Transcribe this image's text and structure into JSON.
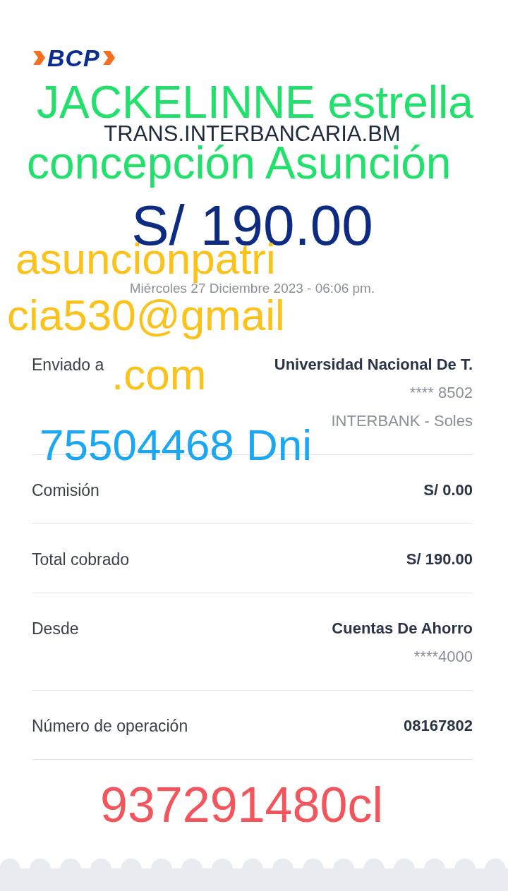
{
  "logo": {
    "text": "BCP"
  },
  "title": "TRANS.INTERBANCARIA.BM",
  "amount": "S/ 190.00",
  "date": "Miércoles 27 Diciembre 2023 - 06:06 pm.",
  "details": [
    {
      "label": "Enviado a",
      "values": [
        "Universidad Nacional De T.",
        "**** 8502",
        "INTERBANK - Soles"
      ]
    },
    {
      "label": "Comisión",
      "values": [
        "S/ 0.00"
      ]
    },
    {
      "label": "Total cobrado",
      "values": [
        "S/ 190.00"
      ]
    },
    {
      "label": "Desde",
      "values": [
        "Cuentas De Ahorro",
        "****4000"
      ]
    },
    {
      "label": "Número de operación",
      "values": [
        "08167802"
      ]
    }
  ],
  "annotations": [
    {
      "text": "JACKELINNE estrella",
      "color": "#22e06c"
    },
    {
      "text": "concepción Asunción",
      "color": "#22e06c"
    },
    {
      "text": "asuncionpatri",
      "color": "#fbc21c"
    },
    {
      "text": "cia530@gmail",
      "color": "#fbc21c"
    },
    {
      "text": ".com",
      "color": "#fbc21c"
    },
    {
      "text": "75504468 Dni",
      "color": "#1ba7f2"
    },
    {
      "text": "937291480cl",
      "color": "#f2555c"
    }
  ]
}
